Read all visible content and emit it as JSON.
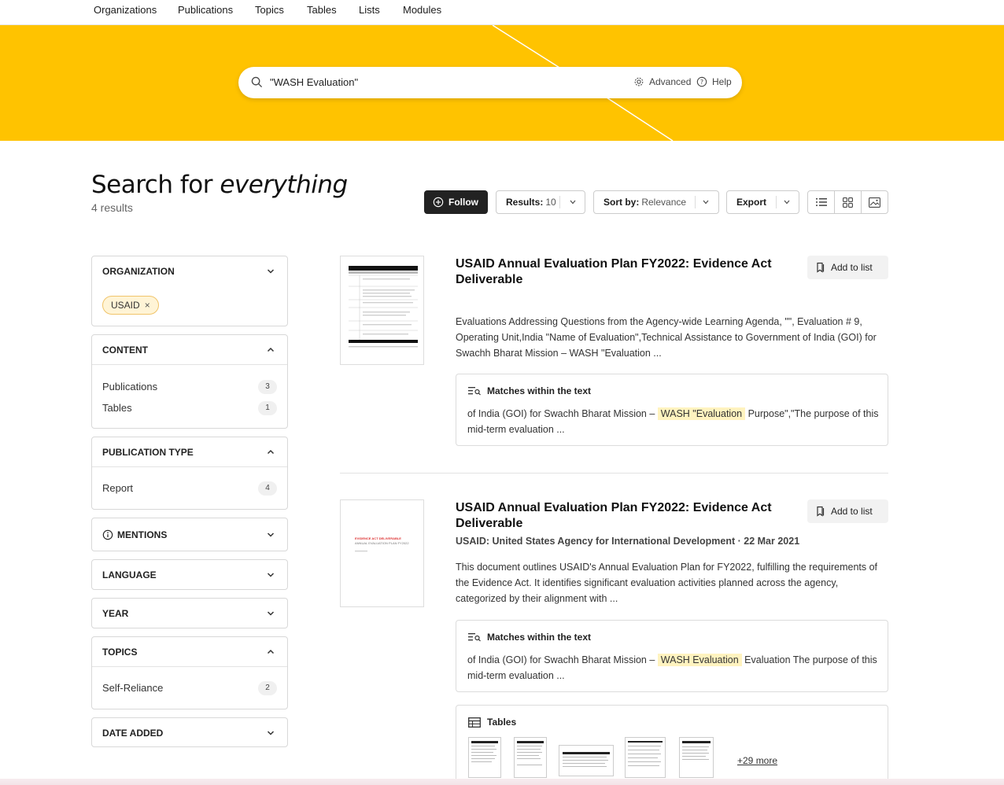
{
  "nav": [
    "Organizations",
    "Publications",
    "Topics",
    "Tables",
    "Lists",
    "Modules"
  ],
  "search": {
    "query": "\"WASH Evaluation\"",
    "advanced": "Advanced",
    "help": "Help"
  },
  "heading": {
    "prefix": "Search for ",
    "emphasis": "everything",
    "count": "4 results"
  },
  "toolbar": {
    "follow": "Follow",
    "results_label": "Results:",
    "results_value": "10",
    "sort_label": "Sort by:",
    "sort_value": "Relevance",
    "export": "Export"
  },
  "filters": {
    "organization": {
      "title": "ORGANIZATION",
      "chip": "USAID"
    },
    "content": {
      "title": "CONTENT",
      "items": [
        {
          "label": "Publications",
          "count": "3"
        },
        {
          "label": "Tables",
          "count": "1"
        }
      ]
    },
    "publication_type": {
      "title": "PUBLICATION TYPE",
      "items": [
        {
          "label": "Report",
          "count": "4"
        }
      ]
    },
    "mentions": {
      "title": "MENTIONS"
    },
    "language": {
      "title": "LANGUAGE"
    },
    "year": {
      "title": "YEAR"
    },
    "topics": {
      "title": "TOPICS",
      "items": [
        {
          "label": "Self-Reliance",
          "count": "2"
        }
      ]
    },
    "date_added": {
      "title": "DATE ADDED"
    }
  },
  "results": [
    {
      "title": "USAID Annual Evaluation Plan FY2022: Evidence Act Deliverable",
      "add_to_list": "Add to list",
      "description": "Evaluations Addressing Questions from the Agency-wide Learning Agenda, \"\", Evaluation # 9, Operating Unit,India \"Name of Evaluation\",Technical Assistance to Government of India (GOI) for Swachh Bharat Mission – WASH \"Evaluation ...",
      "matches_header": "Matches within the text",
      "match_before": "of India (GOI) for Swachh Bharat Mission –",
      "match_highlight": "WASH \"Evaluation",
      "match_after": "Purpose\",\"The purpose of this mid-term evaluation  ..."
    },
    {
      "title": "USAID Annual Evaluation Plan FY2022: Evidence Act Deliverable",
      "add_to_list": "Add to list",
      "meta": "USAID: United States Agency for International Development · 22 Mar 2021",
      "description": "This document outlines USAID's Annual Evaluation Plan for FY2022, fulfilling the requirements of the Evidence Act. It identifies significant evaluation activities planned across the agency, categorized by their alignment with ...",
      "matches_header": "Matches within the text",
      "match_before": "of India (GOI) for Swachh Bharat Mission –",
      "match_highlight": "WASH Evaluation",
      "match_after": "Evaluation The purpose of this mid-term evaluation  ...",
      "thumb_line1": "EVIDENCE ACT DELIVERABLE",
      "thumb_line2": "ANNUAL EVALUATION PLAN FY2022",
      "tables_header": "Tables",
      "tables_more": "+29 more"
    }
  ],
  "colors": {
    "hero": "#ffc300",
    "highlight": "#fff3bf",
    "chip_bg": "#fff4d6",
    "follow_bg": "#222222"
  }
}
